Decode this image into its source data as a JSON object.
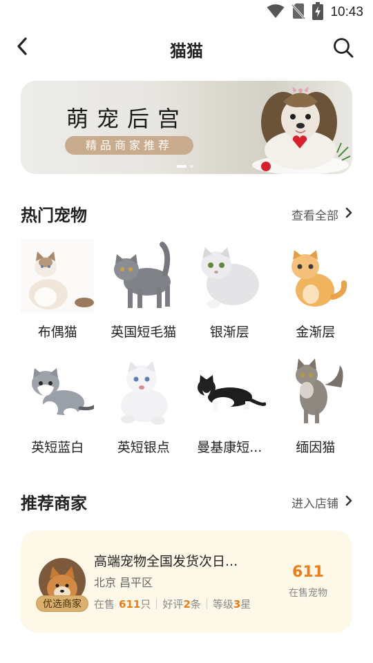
{
  "status_bar": {
    "time": "10:43",
    "icons": [
      "wifi-icon",
      "no-sim-icon",
      "battery-charging-icon"
    ]
  },
  "header": {
    "title": "猫猫",
    "back_icon": "chevron-left-icon",
    "search_icon": "search-icon"
  },
  "banner": {
    "title": "萌宠后宫",
    "subtitle": "精品商家推荐",
    "slides_total": 2,
    "active_slide": 1
  },
  "hot_pets": {
    "title": "热门宠物",
    "more_label": "查看全部",
    "items": [
      {
        "name": "布偶猫"
      },
      {
        "name": "英国短毛猫"
      },
      {
        "name": "银渐层"
      },
      {
        "name": "金渐层"
      },
      {
        "name": "英短蓝白"
      },
      {
        "name": "英短银点"
      },
      {
        "name": "曼基康短..."
      },
      {
        "name": "缅因猫"
      }
    ]
  },
  "merchants": {
    "title": "推荐商家",
    "more_label": "进入店铺",
    "card": {
      "badge": "优选商家",
      "name": "高端宠物全国发货次日...",
      "location": "北京 昌平区",
      "stat_onsale_prefix": "在售",
      "stat_onsale_value": "611",
      "stat_onsale_suffix": "只",
      "stat_reviews_prefix": "好评",
      "stat_reviews_value": "2",
      "stat_reviews_suffix": "条",
      "stat_level_prefix": "等级",
      "stat_level_value": "3",
      "stat_level_suffix": "星",
      "count": "611",
      "count_label": "在售宠物"
    }
  },
  "colors": {
    "accent": "#f07c16",
    "banner_pill": "#c9ab8d",
    "card_bg": "#fdf8e8",
    "badge": "#d9b06e"
  }
}
